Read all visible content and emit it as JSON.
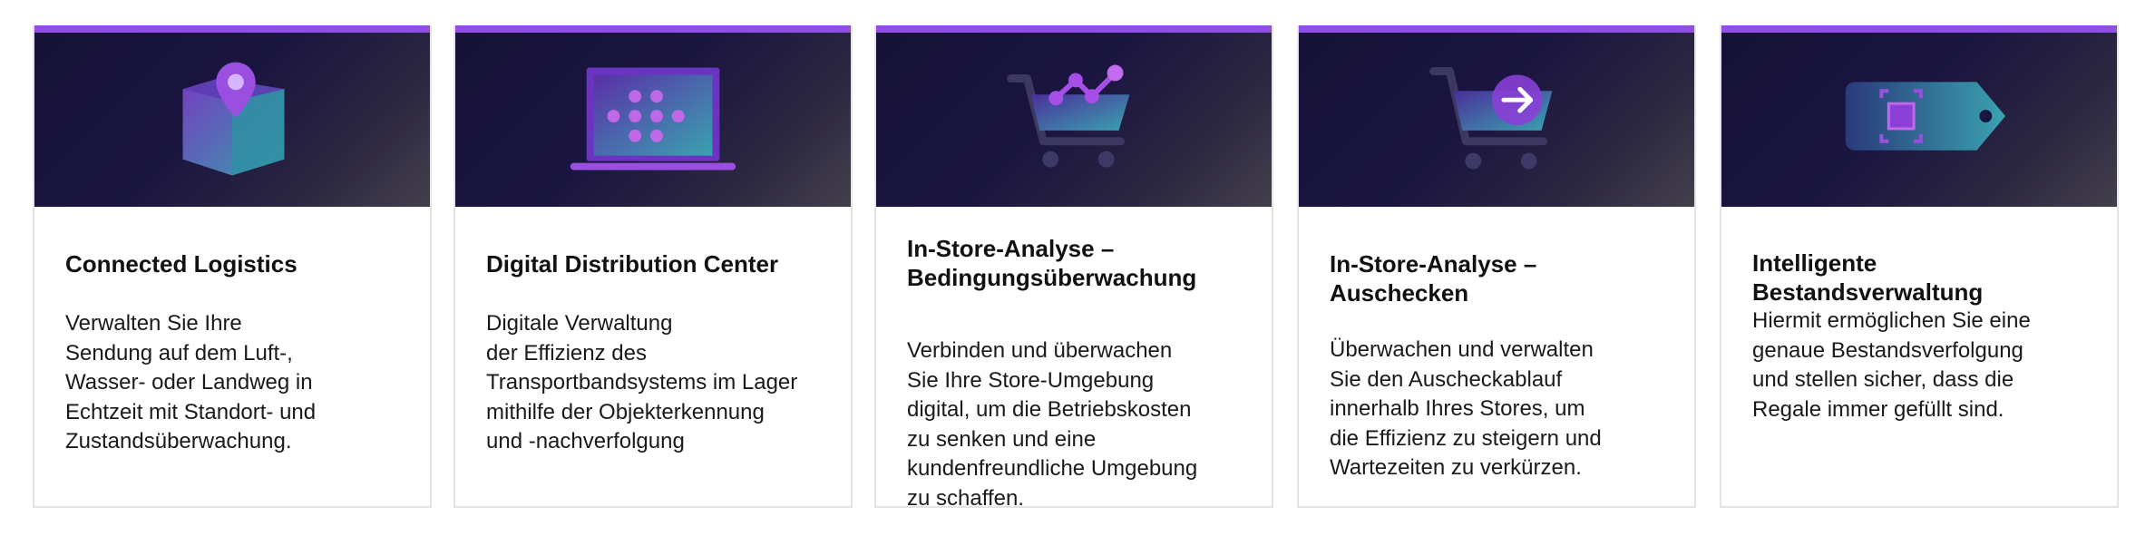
{
  "cards": [
    {
      "title": "Connected Logistics",
      "description": "Verwalten Sie Ihre\nSendung auf dem Luft-,\nWasser- oder Landweg in\nEchtzeit mit Standort- und\nZustandsüberwachung.",
      "icon": "package-location-icon"
    },
    {
      "title": "Digital Distribution Center",
      "description": "Digitale Verwaltung\nder Effizienz des\nTransportbandsystems im Lager\nmithilfe der Objekterkennung\nund -nachverfolgung",
      "icon": "laptop-network-icon"
    },
    {
      "title": "In-Store-Analyse –\nBedingungsüberwachung",
      "description": "Verbinden und überwachen\nSie Ihre Store-Umgebung\ndigital, um die Betriebskosten\nzu senken und eine\nkundenfreundliche Umgebung\nzu schaffen.",
      "icon": "cart-analytics-icon"
    },
    {
      "title": "In-Store-Analyse – Auschecken",
      "description": "Überwachen und verwalten\nSie den Auscheckablauf\ninnerhalb Ihres Stores, um\ndie Effizienz zu steigern und\nWartezeiten zu verkürzen.",
      "icon": "cart-checkout-icon"
    },
    {
      "title": "Intelligente Bestandsverwaltung",
      "description": "Hiermit ermöglichen Sie eine\ngenaue Bestandsverfolgung\nund stellen sicher, dass die\nRegale immer gefüllt sind.",
      "icon": "price-tag-scan-icon"
    }
  ],
  "colors": {
    "accent": "#8f4fe6",
    "hero_dark": "#161136",
    "icon_teal": "#3fa3b3",
    "icon_purple": "#8a3fd6"
  }
}
